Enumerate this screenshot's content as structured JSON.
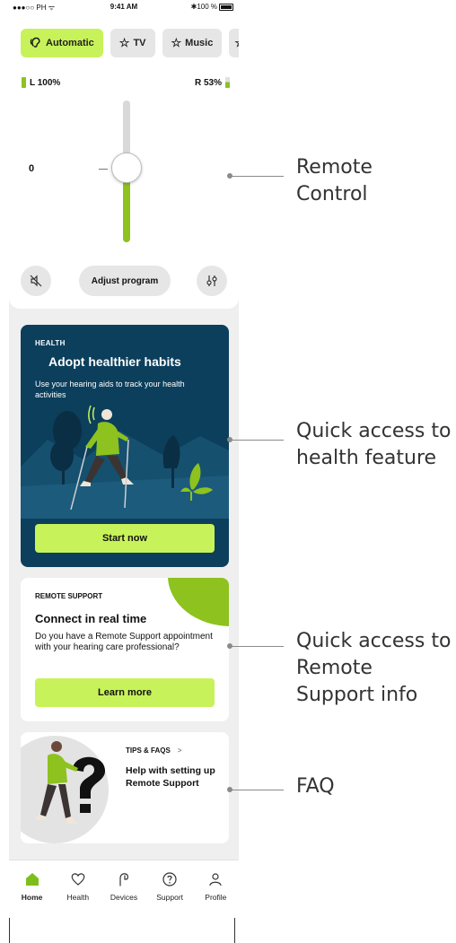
{
  "status_bar": {
    "carrier": "●●●○○ PH ᯤ",
    "time": "9:41 AM",
    "battery": "✱100 %"
  },
  "programs": [
    {
      "label": "Automatic",
      "icon": "ear-icon",
      "active": true
    },
    {
      "label": "TV",
      "icon": "star-icon",
      "active": false
    },
    {
      "label": "Music",
      "icon": "star-icon",
      "active": false
    }
  ],
  "battery": {
    "left_label": "L 100%",
    "right_label": "R 53%",
    "left_level": 1.0,
    "right_level": 0.53
  },
  "volume": {
    "value": "0",
    "level": 0.43
  },
  "controls": {
    "adjust_label": "Adjust program"
  },
  "health": {
    "kicker": "HEALTH",
    "title": "Adopt healthier habits",
    "description": "Use your hearing aids to track your health activities",
    "cta": "Start now"
  },
  "remote_support": {
    "kicker": "REMOTE SUPPORT",
    "title": "Connect in real time",
    "description": "Do you have a Remote Support appointment with your hearing care professional?",
    "cta": "Learn more"
  },
  "faq": {
    "kicker": "TIPS & FAQS",
    "chevron": ">",
    "title": "Help with setting up Remote Support"
  },
  "tabs": [
    {
      "label": "Home",
      "icon": "home-icon",
      "active": true
    },
    {
      "label": "Health",
      "icon": "heart-icon",
      "active": false
    },
    {
      "label": "Devices",
      "icon": "hearing-aid-icon",
      "active": false
    },
    {
      "label": "Support",
      "icon": "question-icon",
      "active": false
    },
    {
      "label": "Profile",
      "icon": "person-icon",
      "active": false
    }
  ],
  "callouts": {
    "remote_control": "Remote\nControl",
    "health": "Quick access to\nhealth feature",
    "remote_support": "Quick access to\nRemote\nSupport info",
    "faq": "FAQ"
  },
  "colors": {
    "accent": "#c8f25a",
    "green": "#8dc21f",
    "health_bg": "#0b3f5c",
    "app_bg": "#efefef"
  }
}
